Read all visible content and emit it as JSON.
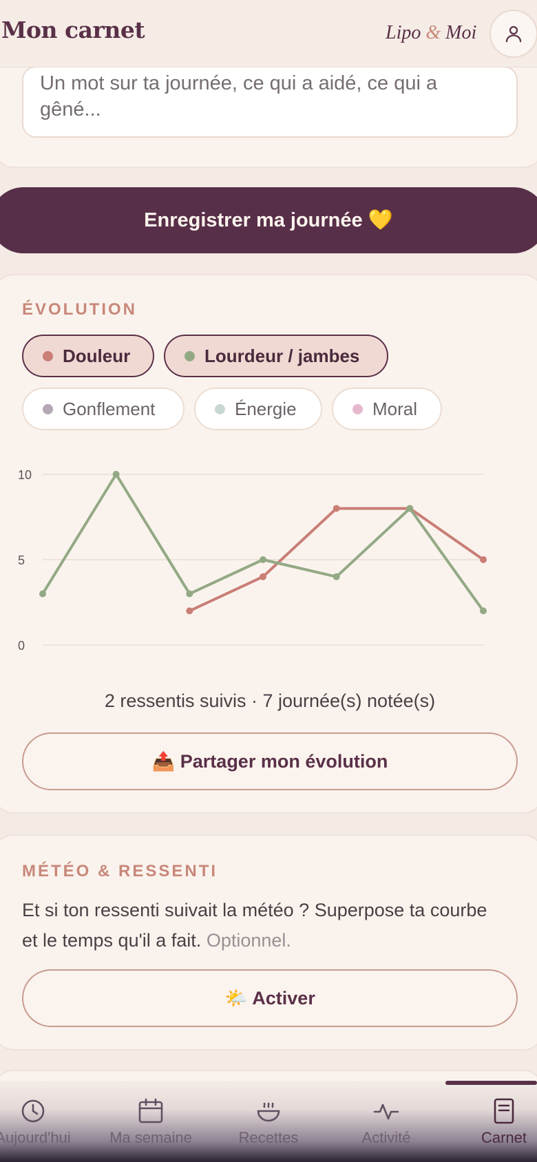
{
  "header": {
    "title": "Mon carnet",
    "brand_a": "Lipo",
    "brand_amp": "&",
    "brand_b": "Moi"
  },
  "note": {
    "placeholder": "Un mot sur ta journée, ce qui a aidé, ce qui a gêné..."
  },
  "save_button": "Enregistrer ma journée 💛",
  "evolution": {
    "label": "ÉVOLUTION",
    "chips": [
      {
        "label": "Douleur",
        "active": true,
        "color": "#c97e76"
      },
      {
        "label": "Lourdeur / jambes",
        "active": true,
        "color": "#93a985"
      },
      {
        "label": "Gonflement",
        "active": false,
        "color": "#b3a8b3"
      },
      {
        "label": "Énergie",
        "active": false,
        "color": "#c9d8d3"
      },
      {
        "label": "Moral",
        "active": false,
        "color": "#e6b8ce"
      }
    ],
    "summary": "2 ressentis suivis · 7 journée(s) notée(s)",
    "share_button": "📤 Partager mon évolution"
  },
  "chart_data": {
    "type": "line",
    "x": [
      1,
      2,
      3,
      4,
      5,
      6,
      7
    ],
    "ylim": [
      0,
      10
    ],
    "yticks": [
      "0",
      "5",
      "10"
    ],
    "grid": true,
    "series": [
      {
        "name": "Douleur",
        "color": "#c97e76",
        "values": [
          null,
          null,
          2,
          4,
          8,
          8,
          5
        ]
      },
      {
        "name": "Lourdeur / jambes",
        "color": "#93a985",
        "values": [
          3,
          10,
          3,
          5,
          4,
          8,
          2
        ]
      }
    ]
  },
  "meteo": {
    "label": "MÉTÉO & RESSENTI",
    "text": "Et si ton ressenti suivait la météo ? Superpose ta courbe et le temps qu'il a fait.",
    "optional": "Optionnel.",
    "activate_button": "🌤️ Activer"
  },
  "nav": {
    "items": [
      {
        "label": "Aujourd'hui",
        "icon": "clock-icon"
      },
      {
        "label": "Ma semaine",
        "icon": "calendar-icon"
      },
      {
        "label": "Recettes",
        "icon": "bowl-icon"
      },
      {
        "label": "Activité",
        "icon": "activity-icon"
      },
      {
        "label": "Carnet",
        "icon": "notebook-icon"
      }
    ],
    "current": "Carnet"
  }
}
